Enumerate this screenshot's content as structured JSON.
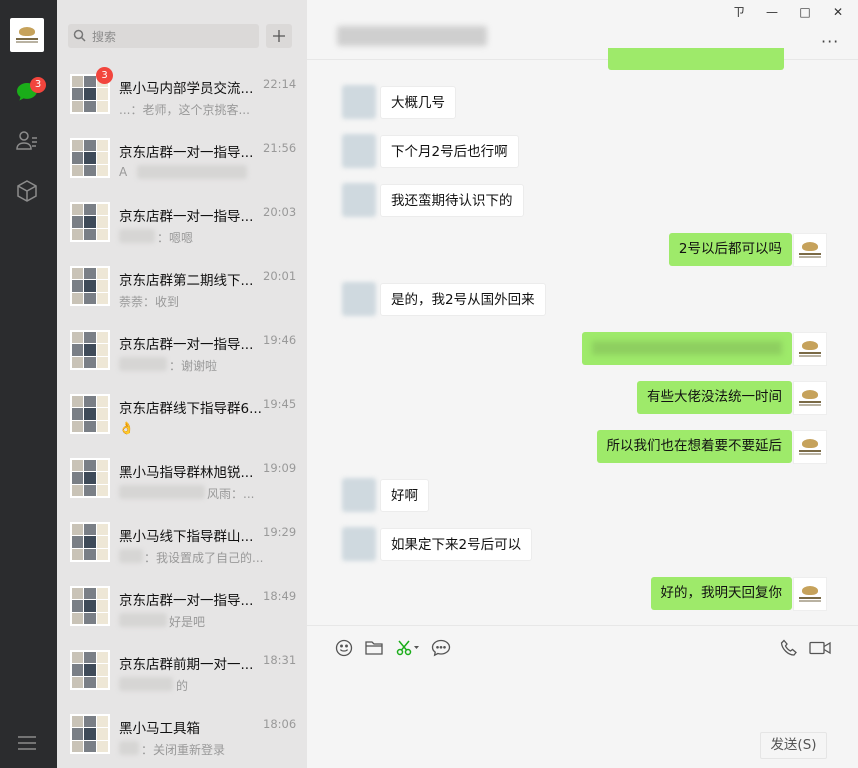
{
  "nav": {
    "chat_badge": "3"
  },
  "search": {
    "placeholder": "搜索"
  },
  "conversations": [
    {
      "title": "黑小马内部学员交流...",
      "time": "22:14",
      "preview": "...：老师，这个京挑客...",
      "badge": "3"
    },
    {
      "title": "京东店群一对一指导...",
      "time": "21:56",
      "preview": "A"
    },
    {
      "title": "京东店群一对一指导...",
      "time": "20:03",
      "preview": "：嗯嗯"
    },
    {
      "title": "京东店群第二期线下...",
      "time": "20:01",
      "preview": "萘萘：收到"
    },
    {
      "title": "京东店群一对一指导...",
      "time": "19:46",
      "preview": "：谢谢啦"
    },
    {
      "title": "京东店群线下指导群6...",
      "time": "19:45",
      "preview": "👌"
    },
    {
      "title": "黑小马指导群林旭锐...",
      "time": "19:09",
      "preview": "风雨：..."
    },
    {
      "title": "黑小马线下指导群山...",
      "time": "19:29",
      "preview": "：我设置成了自己的..."
    },
    {
      "title": "京东店群一对一指导...",
      "time": "18:49",
      "preview": "好是吧"
    },
    {
      "title": "京东店群前期一对一...",
      "time": "18:31",
      "preview": "的"
    },
    {
      "title": "黑小马工具箱",
      "time": "18:06",
      "preview": "：关闭重新登录"
    }
  ],
  "window": {
    "pin": "ㄗ",
    "minimize": "—",
    "maximize": "□",
    "close": "✕",
    "more": "···"
  },
  "messages": [
    {
      "dir": "in",
      "text": "大概几号"
    },
    {
      "dir": "in",
      "text": "下个月2号后也行啊"
    },
    {
      "dir": "in",
      "text": "我还蛮期待认识下的"
    },
    {
      "dir": "out",
      "text": "2号以后都可以吗"
    },
    {
      "dir": "in",
      "text": "是的，我2号从国外回来"
    },
    {
      "dir": "out",
      "text": ""
    },
    {
      "dir": "out",
      "text": "有些大佬没法统一时间"
    },
    {
      "dir": "out",
      "text": "所以我们也在想着要不要延后"
    },
    {
      "dir": "in",
      "text": "好啊"
    },
    {
      "dir": "in",
      "text": "如果定下来2号后可以"
    },
    {
      "dir": "out",
      "text": "好的，我明天回复你"
    }
  ],
  "composer": {
    "send_label": "发送(S)"
  },
  "colors": {
    "sidebar": "#2b2c2e",
    "list_bg": "#e6e5e5",
    "active_row": "#cbcaca",
    "outgoing_bubble": "#9eea6a",
    "badge": "#f2453d",
    "chat_bg": "#f5f5f5"
  }
}
